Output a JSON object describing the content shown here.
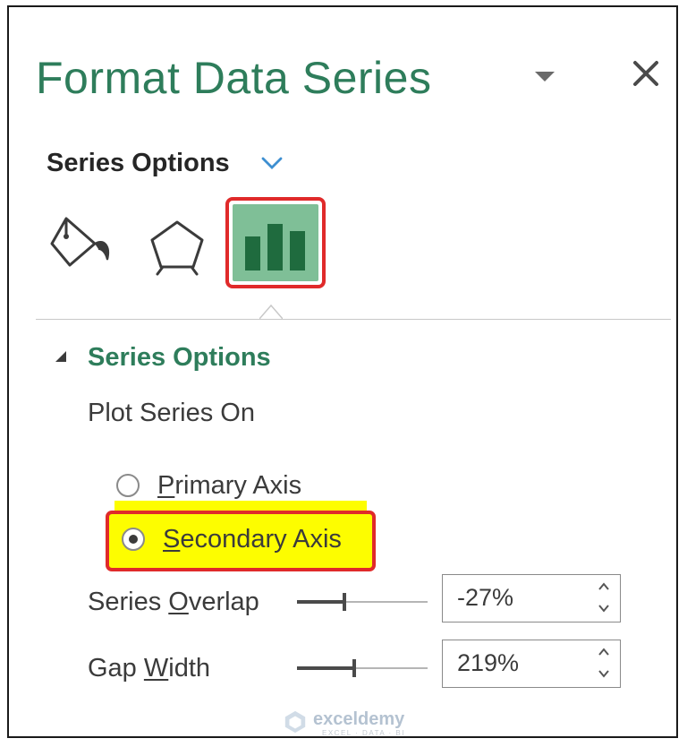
{
  "pane": {
    "title": "Format Data Series",
    "section_menu_label": "Series Options"
  },
  "tabs": [
    {
      "name": "Fill & Line",
      "icon": "paint-bucket-icon"
    },
    {
      "name": "Effects",
      "icon": "pentagon-icon"
    },
    {
      "name": "Series Options",
      "icon": "bar-chart-icon",
      "selected": true
    }
  ],
  "series_options": {
    "group_title": "Series Options",
    "plot_series_on_label": "Plot Series On",
    "primary_axis": {
      "label_first": "P",
      "label_rest": "rimary Axis",
      "checked": false
    },
    "secondary_axis": {
      "label_first": "S",
      "label_rest": "econdary Axis",
      "checked": true
    },
    "series_overlap": {
      "label_before": "Series ",
      "label_ul": "O",
      "label_after": "verlap",
      "value": "-27%",
      "slider_fraction": 0.365
    },
    "gap_width": {
      "label_before": "Gap ",
      "label_ul": "W",
      "label_after": "idth",
      "value": "219%",
      "slider_fraction": 0.438
    }
  },
  "colors": {
    "accent_green": "#2e7d5b",
    "highlight_yellow": "#fdfd00",
    "callout_red": "#e02a2a",
    "selected_tab_bg": "#7fbf97"
  },
  "watermark": {
    "brand": "exceldemy",
    "tagline": "EXCEL · DATA · BI"
  }
}
